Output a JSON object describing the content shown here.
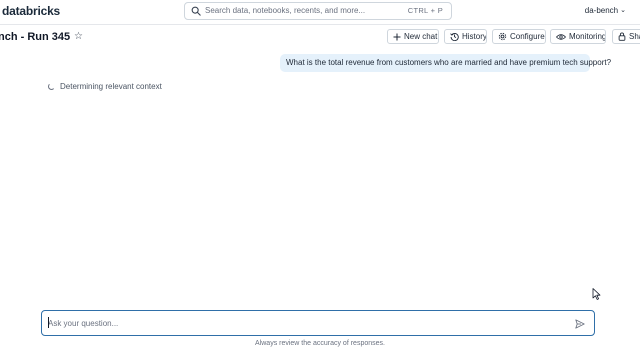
{
  "header": {
    "logo": "databricks",
    "search": {
      "placeholder": "Search data, notebooks, recents, and more...",
      "shortcut": "CTRL + P"
    },
    "workspace": "da-bench"
  },
  "page": {
    "title": "nch - Run 345",
    "buttons": {
      "new_chat": "New chat",
      "history": "History",
      "configure": "Configure",
      "monitoring": "Monitoring",
      "share": "Sha"
    }
  },
  "chat": {
    "user_message": "What is the total revenue from customers who are married and have premium tech support?",
    "status": "Determining relevant context"
  },
  "composer": {
    "placeholder": "Ask your question...",
    "disclaimer": "Always review the accuracy of responses."
  },
  "colors": {
    "accent_border": "#2f6fa8",
    "bubble_bg": "#e5f1fb"
  },
  "icons": [
    "search-icon",
    "chevron-down-icon",
    "star-icon",
    "plus-icon",
    "history-icon",
    "gear-icon",
    "eye-icon",
    "lock-icon",
    "spinner-icon",
    "send-icon",
    "mouse-cursor-icon"
  ]
}
